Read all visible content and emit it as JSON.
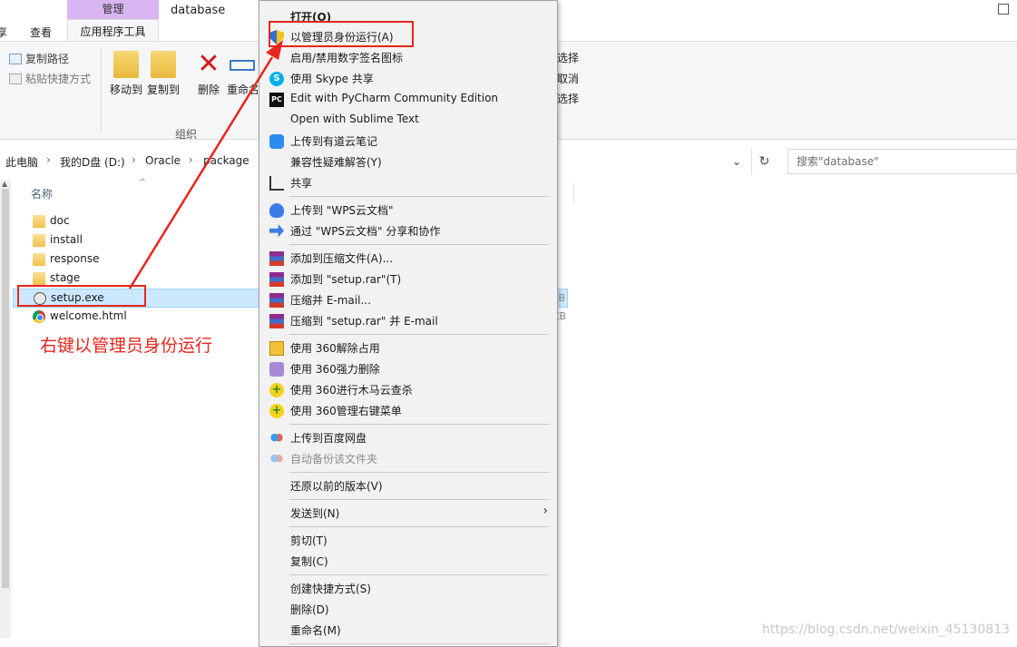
{
  "window": {
    "title": "database"
  },
  "tabs": {
    "contextual_header": "管理",
    "contextual_tab": "应用程序工具",
    "view_tab": "查看",
    "left_cut": "享"
  },
  "ribbon": {
    "copy_path": "复制路径",
    "paste_shortcut": "粘贴快捷方式",
    "move_to": "移动到",
    "copy_to": "复制到",
    "delete": "删除",
    "rename": "重命名",
    "group_label": "组织",
    "right_select": "选择",
    "right_cancel": "取消",
    "right_select2": "选择"
  },
  "address": {
    "crumbs": [
      "此电脑",
      "我的D盘 (D:)",
      "Oracle",
      "package"
    ],
    "search_placeholder": "搜索\"database\""
  },
  "filelist": {
    "column_name": "名称",
    "files": [
      {
        "name": "doc",
        "type": "folder"
      },
      {
        "name": "install",
        "type": "folder"
      },
      {
        "name": "response",
        "type": "folder"
      },
      {
        "name": "stage",
        "type": "folder"
      },
      {
        "name": "setup.exe",
        "type": "exe",
        "size": "KB",
        "selected": true
      },
      {
        "name": "welcome.html",
        "type": "html",
        "size": "KB"
      }
    ]
  },
  "annotation": {
    "note": "右键以管理员身份运行",
    "accent_color": "#e8261d"
  },
  "context_menu": {
    "items": [
      {
        "label": "打开(O)",
        "icon": "none",
        "bold": true
      },
      {
        "label": "以管理员身份运行(A)",
        "icon": "uac-shield-icon",
        "highlighted": true
      },
      {
        "label": "启用/禁用数字签名图标",
        "icon": "none"
      },
      {
        "label": "使用 Skype 共享",
        "icon": "skype-icon"
      },
      {
        "label": "Edit with PyCharm Community Edition",
        "icon": "pycharm-icon"
      },
      {
        "label": "Open with Sublime Text",
        "icon": "none"
      },
      {
        "label": "上传到有道云笔记",
        "icon": "youdao-icon"
      },
      {
        "label": "兼容性疑难解答(Y)",
        "icon": "none"
      },
      {
        "label": "共享",
        "icon": "share-icon"
      },
      {
        "label": "上传到 \"WPS云文档\"",
        "icon": "wps-cloud-icon"
      },
      {
        "label": "通过 \"WPS云文档\" 分享和协作",
        "icon": "wps-share-icon"
      },
      {
        "label": "添加到压缩文件(A)...",
        "icon": "winrar-icon"
      },
      {
        "label": "添加到 \"setup.rar\"(T)",
        "icon": "winrar-icon"
      },
      {
        "label": "压缩并 E-mail...",
        "icon": "winrar-icon"
      },
      {
        "label": "压缩到 \"setup.rar\" 并 E-mail",
        "icon": "winrar-icon"
      },
      {
        "label": "使用 360解除占用",
        "icon": "360-unlock-icon"
      },
      {
        "label": "使用 360强力删除",
        "icon": "360-delete-icon"
      },
      {
        "label": "使用 360进行木马云查杀",
        "icon": "360-scan-icon"
      },
      {
        "label": "使用 360管理右键菜单",
        "icon": "360-menu-icon"
      },
      {
        "label": "上传到百度网盘",
        "icon": "baidu-netdisk-icon"
      },
      {
        "label": "自动备份该文件夹",
        "icon": "baidu-netdisk-icon",
        "disabled": true
      },
      {
        "label": "还原以前的版本(V)",
        "icon": "none"
      },
      {
        "label": "发送到(N)",
        "icon": "none",
        "submenu": true
      },
      {
        "label": "剪切(T)",
        "icon": "none"
      },
      {
        "label": "复制(C)",
        "icon": "none"
      },
      {
        "label": "创建快捷方式(S)",
        "icon": "none"
      },
      {
        "label": "删除(D)",
        "icon": "none"
      },
      {
        "label": "重命名(M)",
        "icon": "none"
      }
    ]
  },
  "watermark": "https://blog.csdn.net/weixin_45130813"
}
